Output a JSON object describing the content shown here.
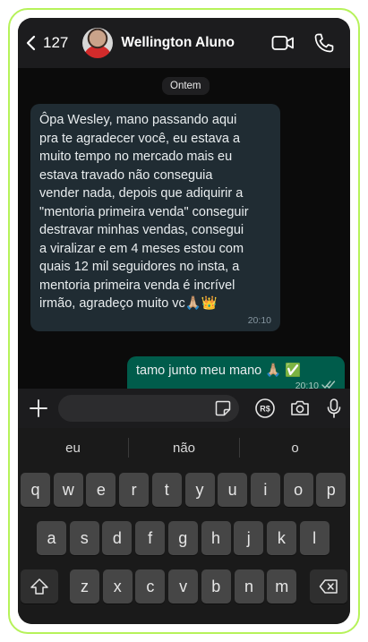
{
  "header": {
    "back_count": "127",
    "contact_name": "Wellington Aluno"
  },
  "chat": {
    "date_label": "Ontem",
    "incoming": {
      "text": "Ôpa Wesley, mano passando aqui\npra te agradecer você, eu estava a\nmuito tempo no mercado mais eu\nestava travado não conseguia\nvender nada, depois que adiquirir a\n\"mentoria primeira venda\" conseguir\ndestravar minhas vendas, consegui\na viralizar e em 4 meses estou com\nquais 12 mil seguidores no insta, a\nmentoria primeira venda é incrível\nirmão, agradeço muito vc🙏🏼👑",
      "time": "20:10"
    },
    "outgoing": {
      "text": "tamo junto meu mano 🙏🏼 ✅",
      "time": "20:10"
    }
  },
  "composer": {
    "placeholder": ""
  },
  "keyboard": {
    "suggestions": [
      "eu",
      "não",
      "o"
    ],
    "row1": [
      "q",
      "w",
      "e",
      "r",
      "t",
      "y",
      "u",
      "i",
      "o",
      "p"
    ],
    "row2": [
      "a",
      "s",
      "d",
      "f",
      "g",
      "h",
      "j",
      "k",
      "l"
    ],
    "row3": [
      "z",
      "x",
      "c",
      "v",
      "b",
      "n",
      "m"
    ]
  },
  "colors": {
    "frame_border": "#b6f25a",
    "incoming_bubble": "#202c33",
    "outgoing_bubble": "#005c4b",
    "key": "#464646"
  }
}
